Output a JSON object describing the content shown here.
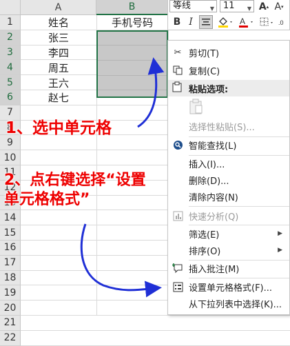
{
  "columns": [
    "A",
    "B"
  ],
  "rows": [
    "1",
    "2",
    "3",
    "4",
    "5",
    "6",
    "7",
    "8",
    "9",
    "10",
    "11",
    "12",
    "13",
    "14",
    "15",
    "16",
    "17",
    "18",
    "19",
    "20",
    "21",
    "22"
  ],
  "cells": {
    "a1": "姓名",
    "b1": "手机号码",
    "names": [
      "张三",
      "李四",
      "周五",
      "王六",
      "赵七"
    ]
  },
  "toolbar": {
    "font": "等线",
    "size": "11",
    "bold": "B",
    "italic": "I",
    "font_color_letter": "A"
  },
  "menu": {
    "cut": "剪切(T)",
    "copy": "复制(C)",
    "paste_options": "粘贴选项:",
    "paste_special": "选择性粘贴(S)...",
    "smart_lookup": "智能查找(L)",
    "insert": "插入(I)...",
    "delete": "删除(D)...",
    "clear": "清除内容(N)",
    "quick_analysis": "快速分析(Q)",
    "filter": "筛选(E)",
    "sort": "排序(O)",
    "insert_comment": "插入批注(M)",
    "format_cells": "设置单元格格式(F)...",
    "pick_list": "从下拉列表中选择(K)..."
  },
  "annotations": {
    "step1": "1、选中单元格",
    "step2_line1": "2、点右键选择“设置",
    "step2_line2": "单元格格式”"
  },
  "colors": {
    "accent_green": "#217346",
    "annotation_red": "#e00000",
    "arrow_blue": "#1f2fd6"
  }
}
